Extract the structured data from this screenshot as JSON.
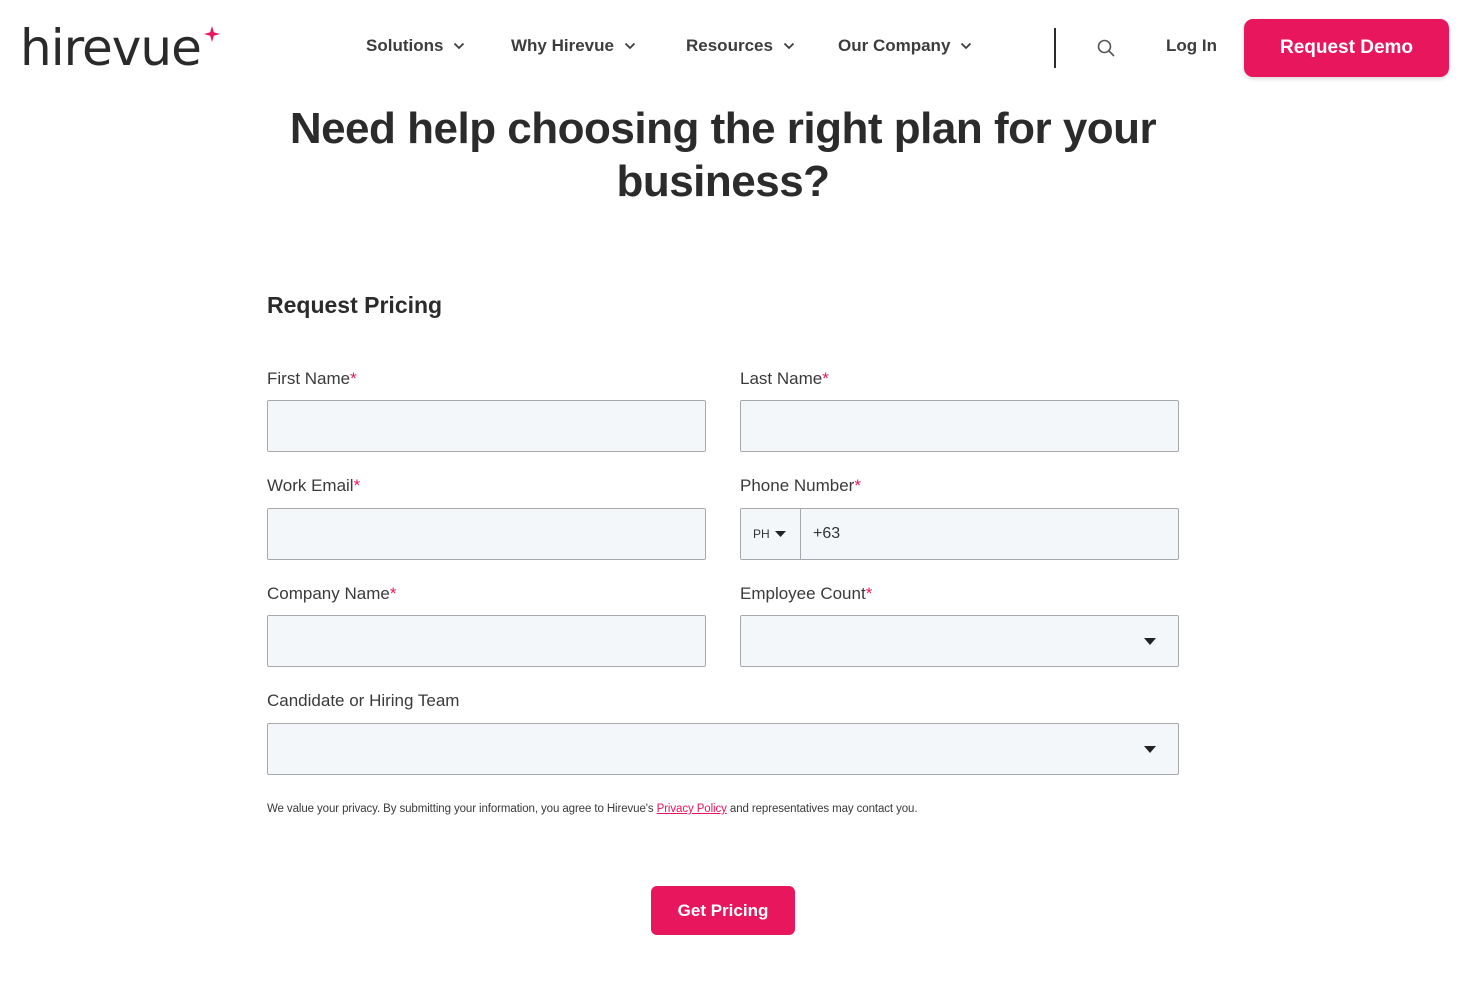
{
  "brand": {
    "logo_text": "hirevue",
    "accent_color": "#e8175d"
  },
  "nav": {
    "items": [
      {
        "label": "Solutions"
      },
      {
        "label": "Why Hirevue"
      },
      {
        "label": "Resources"
      },
      {
        "label": "Our Company"
      }
    ],
    "search_icon": "search-icon",
    "login_label": "Log In",
    "demo_label": "Request Demo"
  },
  "hero": {
    "line1": "Need help choosing the right plan for your",
    "line2": "business?"
  },
  "form": {
    "title": "Request Pricing",
    "required_mark": "*",
    "first_name": {
      "label": "First Name",
      "value": ""
    },
    "last_name": {
      "label": "Last Name",
      "value": ""
    },
    "work_email": {
      "label": "Work Email",
      "value": ""
    },
    "phone": {
      "label": "Phone Number",
      "country": "PH",
      "value": "+63"
    },
    "company_name": {
      "label": "Company Name",
      "value": ""
    },
    "employee_count": {
      "label": "Employee Count",
      "selected": ""
    },
    "team": {
      "label": "Candidate or Hiring Team",
      "selected": ""
    },
    "privacy_before": "We value your privacy. By submitting your information, you agree to Hirevue's ",
    "privacy_link": "Privacy Policy",
    "privacy_after": " and representatives may contact you.",
    "submit_label": "Get Pricing"
  }
}
